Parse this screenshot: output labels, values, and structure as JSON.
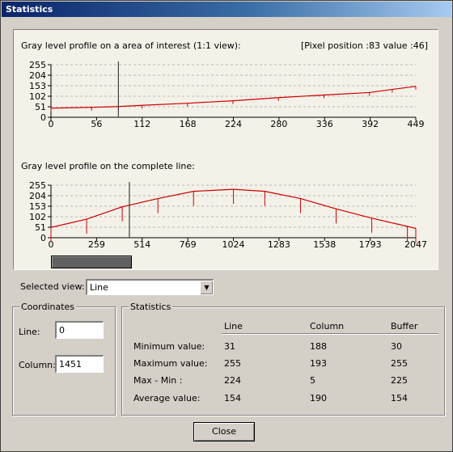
{
  "window": {
    "title": "Statistics"
  },
  "profile1": {
    "title": "Gray level profile on a area of interest (1:1 view):",
    "pixel_info": "[Pixel position :83  value :46]"
  },
  "profile2": {
    "title": "Gray level profile on the complete line:"
  },
  "chart_data": [
    {
      "type": "line",
      "title": "Gray level profile on a area of interest (1:1 view):",
      "xlim": [
        0,
        449
      ],
      "ylim": [
        0,
        255
      ],
      "y_ticks": [
        "255",
        "204",
        "153",
        "102",
        "51",
        "0"
      ],
      "x_ticks": [
        "0",
        "56",
        "112",
        "168",
        "224",
        "280",
        "336",
        "392",
        "449"
      ],
      "x": [
        0,
        50,
        83,
        112,
        168,
        224,
        280,
        336,
        392,
        420,
        449
      ],
      "y": [
        44,
        48,
        52,
        58,
        68,
        80,
        95,
        108,
        120,
        135,
        150
      ],
      "cursor_x": 83,
      "grid": true,
      "series_color": "#cc0000"
    },
    {
      "type": "line",
      "title": "Gray level profile on the complete line:",
      "xlim": [
        0,
        2047
      ],
      "ylim": [
        0,
        255
      ],
      "y_ticks": [
        "255",
        "204",
        "153",
        "102",
        "51",
        "0"
      ],
      "x_ticks": [
        "0",
        "259",
        "514",
        "769",
        "1024",
        "1283",
        "1538",
        "1793",
        "2047"
      ],
      "x": [
        0,
        200,
        400,
        600,
        800,
        1024,
        1200,
        1400,
        1600,
        1800,
        2000,
        2047
      ],
      "y": [
        50,
        90,
        150,
        190,
        225,
        235,
        225,
        190,
        140,
        95,
        55,
        45
      ],
      "cursor_x": 440,
      "grid": true,
      "series_color": "#cc0000"
    }
  ],
  "selected_view": {
    "label": "Selected view:",
    "value": "Line"
  },
  "coordinates": {
    "title": "Coordinates",
    "line_label": "Line:",
    "line_value": "0",
    "column_label": "Column:",
    "column_value": "1451"
  },
  "statistics": {
    "title": "Statistics",
    "headers": [
      "Line",
      "Column",
      "Buffer"
    ],
    "rows": [
      {
        "label": "Minimum value:",
        "values": [
          "31",
          "188",
          "30"
        ]
      },
      {
        "label": "Maximum value:",
        "values": [
          "255",
          "193",
          "255"
        ]
      },
      {
        "label": "Max - Min :",
        "values": [
          "224",
          "5",
          "225"
        ]
      },
      {
        "label": "Average value:",
        "values": [
          "154",
          "190",
          "154"
        ]
      }
    ]
  },
  "close_button": "Close"
}
